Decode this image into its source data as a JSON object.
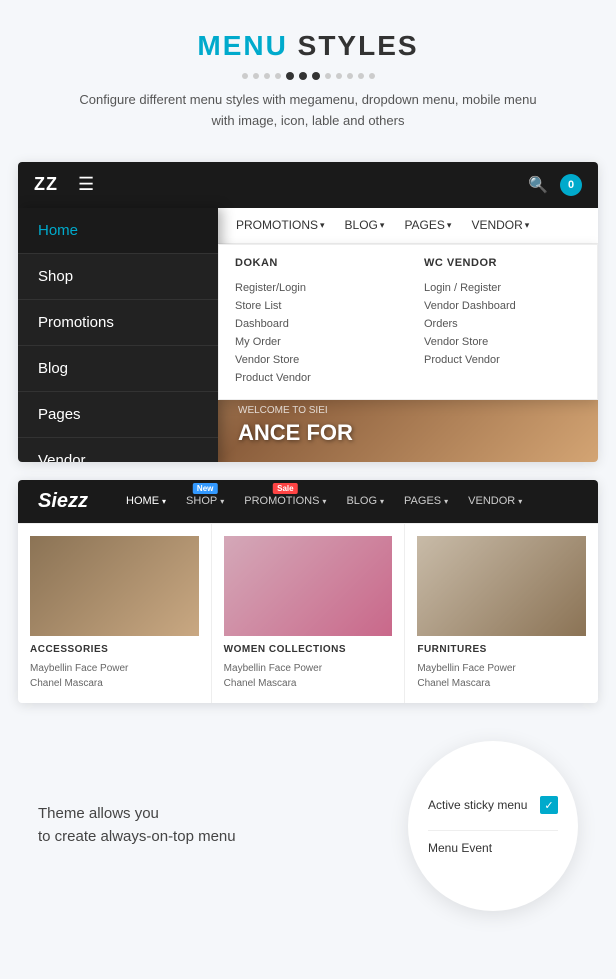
{
  "page": {
    "title": {
      "highlight": "MENU",
      "rest": " STYLES"
    },
    "description": "Configure different menu styles with megamenu, dropdown menu, mobile menu with image, icon, lable and others"
  },
  "dots": {
    "total": 12,
    "active_indices": [
      5,
      6,
      7
    ]
  },
  "demo1": {
    "brand": "ZZ",
    "cart_count": "0",
    "menu_items": [
      {
        "label": "Home",
        "active": true
      },
      {
        "label": "Shop",
        "active": false
      },
      {
        "label": "Promotions",
        "active": false
      },
      {
        "label": "Blog",
        "active": false
      },
      {
        "label": "Pages",
        "active": false
      },
      {
        "label": "Vendor",
        "active": false
      }
    ],
    "secondary_nav": [
      {
        "label": "PROMOTIONS",
        "has_arrow": true
      },
      {
        "label": "BLOG",
        "has_arrow": true
      },
      {
        "label": "PAGES",
        "has_arrow": true
      },
      {
        "label": "VENDOR",
        "has_arrow": true
      }
    ],
    "bg_text": "ANCE FOR",
    "welcome_text": "WELCOME TO SIEI",
    "megamenu": {
      "col1": {
        "title": "DOKAN",
        "links": [
          "Register/Login",
          "Store List",
          "Dashboard",
          "My Order",
          "Vendor Store",
          "Product Vendor"
        ]
      },
      "col2": {
        "title": "WC VENDOR",
        "links": [
          "Login / Register",
          "Vendor Dashboard",
          "Orders",
          "Vendor Store",
          "Product Vendor"
        ]
      }
    }
  },
  "demo2": {
    "brand": "Siezz",
    "nav_items": [
      {
        "label": "HOME",
        "has_arrow": true,
        "badge": null
      },
      {
        "label": "SHOP",
        "has_arrow": true,
        "badge": null
      },
      {
        "label": "PROMOTIONS",
        "has_arrow": true,
        "badge": "Sale"
      },
      {
        "label": "BLOG",
        "has_arrow": true,
        "badge": null
      },
      {
        "label": "PAGES",
        "has_arrow": true,
        "badge": null
      },
      {
        "label": "VENDOR",
        "has_arrow": true,
        "badge": null
      }
    ],
    "badge_new": "New",
    "products": [
      {
        "category": "ACCESSORIES",
        "items": [
          "Maybellin Face Power",
          "Chanel Mascara"
        ]
      },
      {
        "category": "WOMEN COLLECTIONS",
        "items": [
          "Maybellin Face Power",
          "Chanel Mascara"
        ]
      },
      {
        "category": "FURNITURES",
        "items": [
          "Maybellin Face Power",
          "Chanel Mascara"
        ]
      }
    ]
  },
  "sticky": {
    "text_line1": "Theme allows you",
    "text_line2": "to create always-on-top menu",
    "checkbox_label": "Active sticky menu",
    "menu_event_label": "Menu Event"
  }
}
